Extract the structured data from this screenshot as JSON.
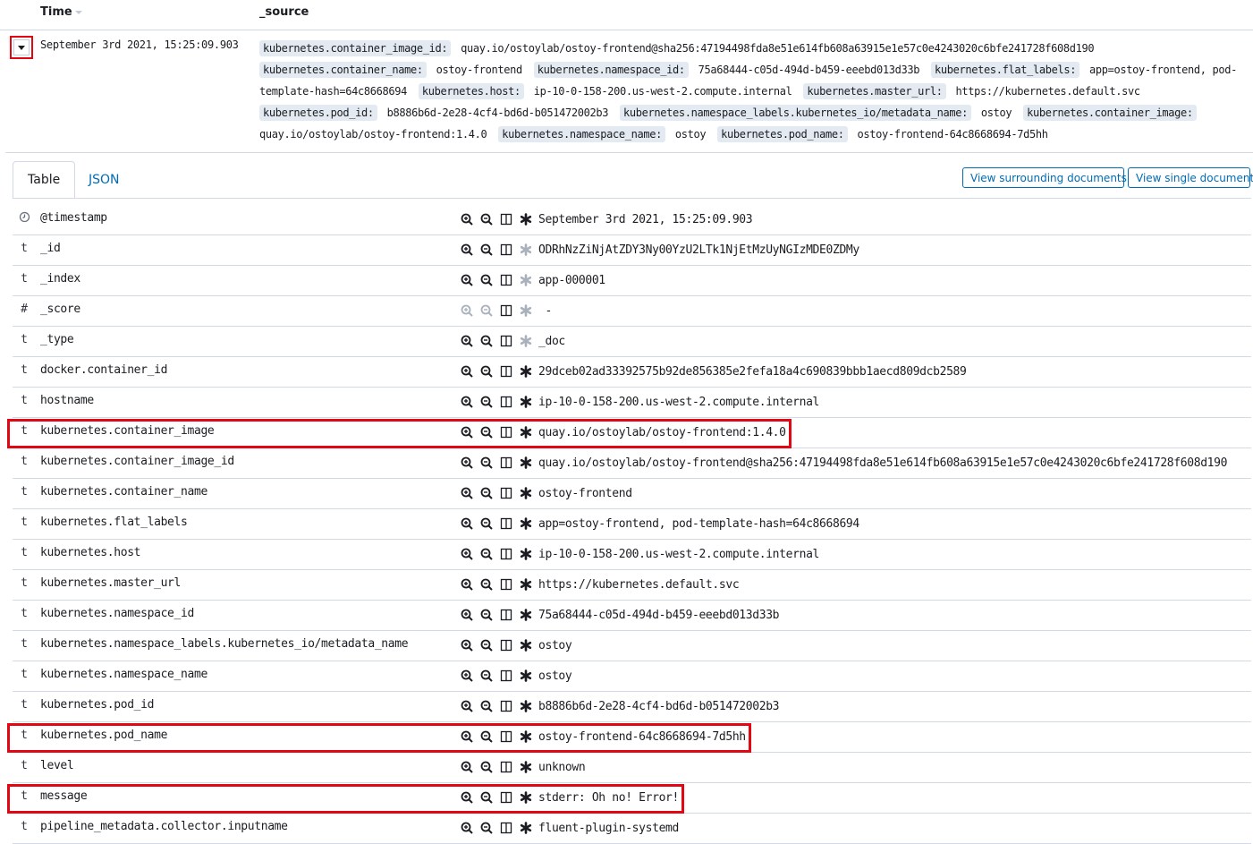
{
  "header": {
    "time_label": "Time",
    "source_label": "_source"
  },
  "document": {
    "time": "September 3rd 2021, 15:25:09.903",
    "source_fields": [
      {
        "key": "kubernetes.container_image_id:",
        "value": "quay.io/ostoylab/ostoy-frontend@sha256:47194498fda8e51e614fb608a63915e1e57c0e4243020c6bfe241728f608d190"
      },
      {
        "key": "kubernetes.container_name:",
        "value": "ostoy-frontend"
      },
      {
        "key": "kubernetes.namespace_id:",
        "value": "75a68444-c05d-494d-b459-eeebd013d33b"
      },
      {
        "key": "kubernetes.flat_labels:",
        "value": "app=ostoy-frontend, pod-template-hash=64c8668694"
      },
      {
        "key": "kubernetes.host:",
        "value": "ip-10-0-158-200.us-west-2.compute.internal"
      },
      {
        "key": "kubernetes.master_url:",
        "value": "https://kubernetes.default.svc"
      },
      {
        "key": "kubernetes.pod_id:",
        "value": "b8886b6d-2e28-4cf4-bd6d-b051472002b3"
      },
      {
        "key": "kubernetes.namespace_labels.kubernetes_io/metadata_name:",
        "value": "ostoy"
      },
      {
        "key": "kubernetes.container_image:",
        "value": "quay.io/ostoylab/ostoy-frontend:1.4.0"
      },
      {
        "key": "kubernetes.namespace_name:",
        "value": "ostoy"
      },
      {
        "key": "kubernetes.pod_name:",
        "value": "ostoy-frontend-64c8668694-7d5hh"
      }
    ]
  },
  "tabs": [
    {
      "label": "Table",
      "active": true
    },
    {
      "label": "JSON",
      "active": false
    }
  ],
  "actions": {
    "view_surrounding": "View surrounding documents",
    "view_single": "View single document"
  },
  "icons": {
    "type_date": "clock-icon",
    "filter_for": "magnify-plus-icon",
    "filter_out": "magnify-minus-icon",
    "toggle_column": "columns-icon",
    "filter_exists": "asterisk-icon"
  },
  "colors": {
    "accent": "#006bb4",
    "highlight": "#e30613",
    "border": "#d3dae6",
    "tag_bg": "#e3eaf1"
  },
  "fields": [
    {
      "type": "clock",
      "name": "@timestamp",
      "value": "September 3rd 2021, 15:25:09.903",
      "filterable": true,
      "exists_enabled": true,
      "highlighted": false
    },
    {
      "type": "t",
      "name": "_id",
      "value": "ODRhNzZiNjAtZDY3Ny00YzU2LTk1NjEtMzUyNGIzMDE0ZDMy",
      "filterable": true,
      "exists_enabled": false,
      "highlighted": false
    },
    {
      "type": "t",
      "name": "_index",
      "value": "app-000001",
      "filterable": true,
      "exists_enabled": false,
      "highlighted": false
    },
    {
      "type": "#",
      "name": "_score",
      "value": " -",
      "filterable": false,
      "exists_enabled": false,
      "highlighted": false
    },
    {
      "type": "t",
      "name": "_type",
      "value": "_doc",
      "filterable": true,
      "exists_enabled": false,
      "highlighted": false
    },
    {
      "type": "t",
      "name": "docker.container_id",
      "value": "29dceb02ad33392575b92de856385e2fefa18a4c690839bbb1aecd809dcb2589",
      "filterable": true,
      "exists_enabled": true,
      "highlighted": false
    },
    {
      "type": "t",
      "name": "hostname",
      "value": "ip-10-0-158-200.us-west-2.compute.internal",
      "filterable": true,
      "exists_enabled": true,
      "highlighted": false
    },
    {
      "type": "t",
      "name": "kubernetes.container_image",
      "value": "quay.io/ostoylab/ostoy-frontend:1.4.0",
      "filterable": true,
      "exists_enabled": true,
      "highlighted": true
    },
    {
      "type": "t",
      "name": "kubernetes.container_image_id",
      "value": "quay.io/ostoylab/ostoy-frontend@sha256:47194498fda8e51e614fb608a63915e1e57c0e4243020c6bfe241728f608d190",
      "filterable": true,
      "exists_enabled": true,
      "highlighted": false
    },
    {
      "type": "t",
      "name": "kubernetes.container_name",
      "value": "ostoy-frontend",
      "filterable": true,
      "exists_enabled": true,
      "highlighted": false
    },
    {
      "type": "t",
      "name": "kubernetes.flat_labels",
      "value": "app=ostoy-frontend, pod-template-hash=64c8668694",
      "filterable": true,
      "exists_enabled": true,
      "highlighted": false
    },
    {
      "type": "t",
      "name": "kubernetes.host",
      "value": "ip-10-0-158-200.us-west-2.compute.internal",
      "filterable": true,
      "exists_enabled": true,
      "highlighted": false
    },
    {
      "type": "t",
      "name": "kubernetes.master_url",
      "value": "https://kubernetes.default.svc",
      "filterable": true,
      "exists_enabled": true,
      "highlighted": false
    },
    {
      "type": "t",
      "name": "kubernetes.namespace_id",
      "value": "75a68444-c05d-494d-b459-eeebd013d33b",
      "filterable": true,
      "exists_enabled": true,
      "highlighted": false
    },
    {
      "type": "t",
      "name": "kubernetes.namespace_labels.kubernetes_io/metadata_name",
      "value": "ostoy",
      "filterable": true,
      "exists_enabled": true,
      "highlighted": false
    },
    {
      "type": "t",
      "name": "kubernetes.namespace_name",
      "value": "ostoy",
      "filterable": true,
      "exists_enabled": true,
      "highlighted": false
    },
    {
      "type": "t",
      "name": "kubernetes.pod_id",
      "value": "b8886b6d-2e28-4cf4-bd6d-b051472002b3",
      "filterable": true,
      "exists_enabled": true,
      "highlighted": false
    },
    {
      "type": "t",
      "name": "kubernetes.pod_name",
      "value": "ostoy-frontend-64c8668694-7d5hh",
      "filterable": true,
      "exists_enabled": true,
      "highlighted": true
    },
    {
      "type": "t",
      "name": "level",
      "value": "unknown",
      "filterable": true,
      "exists_enabled": true,
      "highlighted": false
    },
    {
      "type": "t",
      "name": "message",
      "value": "stderr: Oh no! Error!",
      "filterable": true,
      "exists_enabled": true,
      "highlighted": true
    },
    {
      "type": "t",
      "name": "pipeline_metadata.collector.inputname",
      "value": "fluent-plugin-systemd",
      "filterable": true,
      "exists_enabled": true,
      "highlighted": false
    }
  ]
}
